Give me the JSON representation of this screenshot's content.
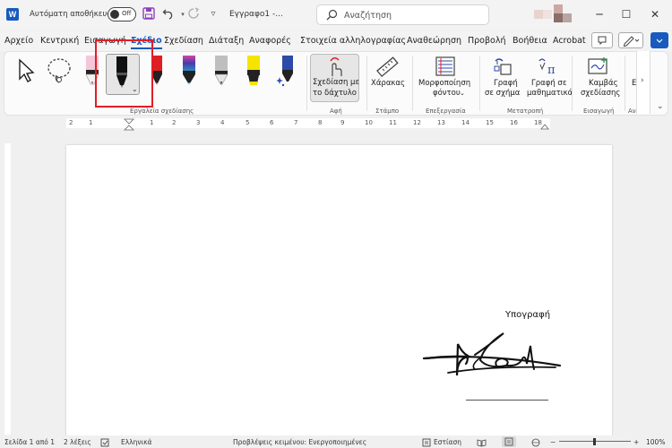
{
  "titlebar": {
    "app_logo_letter": "W",
    "autosave_label": "Αυτόματη αποθήκευση",
    "autosave_state": "Off",
    "doc_title": "Εγγραφο1  -...",
    "search_placeholder": "Αναζήτηση"
  },
  "tabs": [
    {
      "label": "Αρχείο"
    },
    {
      "label": "Κεντρική"
    },
    {
      "label": "Εισαγωγή"
    },
    {
      "label": "Σχέδιο"
    },
    {
      "label": "Σχεδίαση"
    },
    {
      "label": "Διάταξη"
    },
    {
      "label": "Αναφορές"
    },
    {
      "label": "Στοιχεία αλληλογραφίας"
    },
    {
      "label": "Αναθεώρηση"
    },
    {
      "label": "Προβολή"
    },
    {
      "label": "Βοήθεια"
    },
    {
      "label": "Acrobat"
    }
  ],
  "active_tab": "Σχέδιο",
  "ribbon": {
    "groups": {
      "drawing_tools": "Εργαλεία σχεδίασης",
      "touch": "Αφή",
      "stamp": "Στάμπο",
      "edit": "Επεξεργασία",
      "convert": "Μετατροπή",
      "insert": "Εισαγωγή",
      "more": "Αν"
    },
    "draw_touch_line1": "Σχεδίαση με",
    "draw_touch_line2": "το δάχτυλο",
    "ruler": "Χάρακας",
    "background_format_line1": "Μορφοποίηση",
    "background_format_line2": "φόντου",
    "ink_to_shape_line1": "Γραφή",
    "ink_to_shape_line2": "σε σχήμα",
    "ink_to_math_line1": "Γραφή σε",
    "ink_to_math_line2": "μαθηματικά",
    "canvas_line1": "Καμβάς",
    "canvas_line2": "σχεδίασης",
    "cut_letter": "Ε"
  },
  "ruler_numbers": [
    "2",
    "1",
    "1",
    "2",
    "3",
    "4",
    "5",
    "6",
    "7",
    "8",
    "9",
    "10",
    "11",
    "12",
    "13",
    "14",
    "15",
    "16",
    "18"
  ],
  "document": {
    "signature_label": "Υπογραφή"
  },
  "statusbar": {
    "page": "Σελίδα 1 από 1",
    "words": "2 λέξεις",
    "language": "Ελληνικά",
    "predictions": "Προβλέψεις κειμένου: Ενεργοποιημένες",
    "focus": "Εστίαση",
    "zoom": "100%"
  },
  "colors": {
    "accent": "#185abd",
    "highlight_box": "#e01f26",
    "pen_red": "#e21e25",
    "highlighter_yellow": "#f5e400",
    "pen_blue": "#2c4aa8"
  }
}
